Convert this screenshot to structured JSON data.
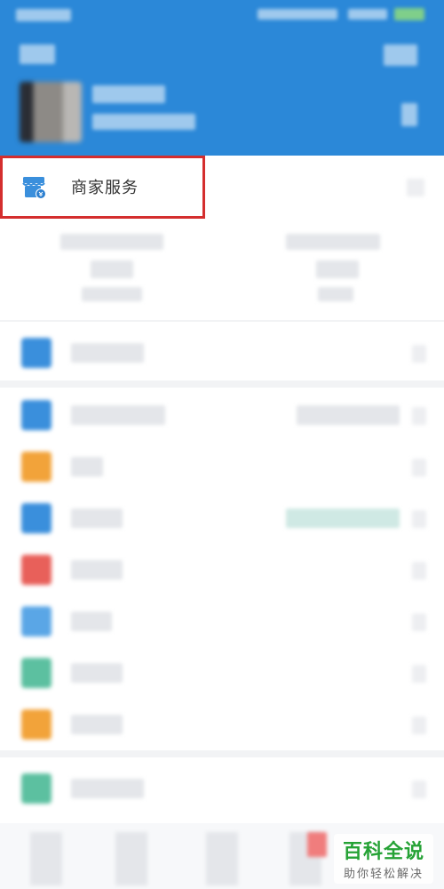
{
  "merchant_service": {
    "label": "商家服务",
    "icon": "store-icon"
  },
  "watermark": {
    "title": "百科全说",
    "subtitle": "助你轻松解决"
  },
  "colors": {
    "header_bg": "#2b88d8",
    "highlight_border": "#d42e2e",
    "icon_blue": "#3a8fdc",
    "icon_orange": "#f2a33a",
    "icon_red": "#e8605a",
    "icon_teal": "#5cc0a0",
    "watermark_green": "#25a235"
  }
}
